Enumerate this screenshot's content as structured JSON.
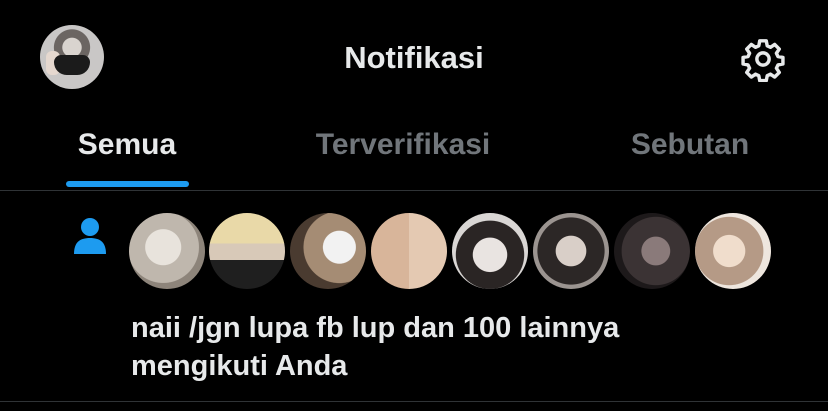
{
  "header": {
    "title": "Notifikasi",
    "profile_icon": "profile-avatar",
    "settings_icon": "gear-icon"
  },
  "tabs": [
    {
      "label": "Semua",
      "active": true
    },
    {
      "label": "Terverifikasi",
      "active": false
    },
    {
      "label": "Sebutan",
      "active": false
    }
  ],
  "notification": {
    "icon": "person-icon",
    "accent_color": "#1d9bf0",
    "avatar_count": 8,
    "names_text": "naii /jgn lupa fb lup dan 100 lainnya",
    "action_text": "mengikuti Anda"
  },
  "colors": {
    "background": "#000000",
    "text_primary": "#e7e9ea",
    "text_secondary": "#71767b",
    "divider": "#2f3336",
    "accent": "#1d9bf0"
  }
}
